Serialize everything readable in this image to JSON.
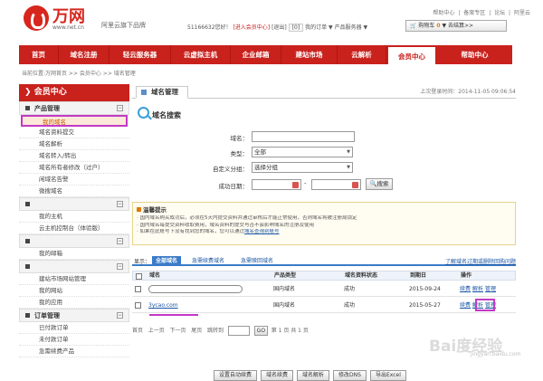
{
  "brand": {
    "logo": "万网",
    "sub": "www.net.cn",
    "tag": "阿里云旗下品牌"
  },
  "toplinks": [
    "帮助中心",
    "备案专区",
    "论坛",
    "阿里云"
  ],
  "userbar": {
    "id": "51166632您好！",
    "enter": "[进入会员中心]",
    "exit": "[退出]",
    "msg": "[0]",
    "orders": "我的订单",
    "product_service": "产品服务器"
  },
  "cart": {
    "label": "购物车",
    "count": "0",
    "checkout": "去结算>>"
  },
  "nav": [
    "首页",
    "域名注册",
    "轻云服务器",
    "云虚拟主机",
    "企业邮箱",
    "建站市场",
    "云解析",
    "会员中心",
    "帮助中心"
  ],
  "nav_active": "会员中心",
  "breadcrumb": "当前位置:万网首页 >> 会员中心 >> 域名管理",
  "sidebar": {
    "title": "会员中心",
    "groups": [
      {
        "name": "产品管理",
        "items": [
          "我的域名",
          "域名资料提交",
          "域名解析",
          "域名转入/转出",
          "域名所有者修改（过户）",
          "闲域名告警",
          "微搜域名"
        ]
      },
      {
        "name": "",
        "items": [
          "我的主机",
          "云主机控制台（体验版）"
        ]
      },
      {
        "name": "",
        "items": [
          "我的邮箱"
        ]
      },
      {
        "name": "",
        "items": [
          "建站市场网站管理",
          "我的网站",
          "我的应用"
        ]
      },
      {
        "name": "订单管理",
        "items": [
          "已付款订单",
          "未付款订单",
          "急需续费产品"
        ]
      }
    ]
  },
  "main": {
    "tab": "域名管理",
    "last_login": "上次登录时间：2014-11-05 09:06:54",
    "search": {
      "title": "域名搜索",
      "domain_label": "域名：",
      "type_label": "类型：",
      "type_value": "全部",
      "group_label": "自定义分组：",
      "group_value": "选择分组",
      "date_label": "成功日期：",
      "date_sep": "-",
      "search_btn": "搜索"
    },
    "tips": {
      "title": "温馨提示",
      "lines": [
        "· 国内域名购买成功后，必须在5天内提交资料并通过审核后才能正常使用，否则域名将被注册局锁定",
        "· 国内域名每提交资料收取费用，域名资料的提交与否不会影响域名的注册及使用",
        "· 如果在此账号下没有找到您的域名，您可以通过"
      ],
      "link": "域名查询到账号"
    },
    "results": {
      "show_label": "显示：",
      "tabs": [
        "全部域名",
        "急需续费域名",
        "急需赎回域名"
      ],
      "help": "了解域名过期或删除回购问题",
      "headers": [
        "域名",
        "产品类型",
        "域名资料状态",
        "到期日",
        "操作"
      ],
      "rows": [
        {
          "domain": "",
          "type": "国内域名",
          "status": "成功",
          "expire": "2015-09-24",
          "ops": [
            "续费",
            "解析",
            "管理"
          ]
        },
        {
          "domain": "3ycao.com",
          "type": "国内域名",
          "status": "成功",
          "expire": "2015-05-27",
          "ops": [
            "续费",
            "解析",
            "管理"
          ]
        }
      ],
      "pager": {
        "first": "首页",
        "prev": "上一页",
        "next": "下一页",
        "last": "尾页",
        "jump": "跳转到",
        "go": "GO",
        "info": "第 1 页 共 1 页"
      }
    },
    "bottom_buttons": [
      "设置自动续费",
      "域名续费",
      "域名解析",
      "修改DNS",
      "导出Excel"
    ]
  },
  "watermark": "Bai度经验",
  "watermark_sub": "jingyan.baidu.com"
}
